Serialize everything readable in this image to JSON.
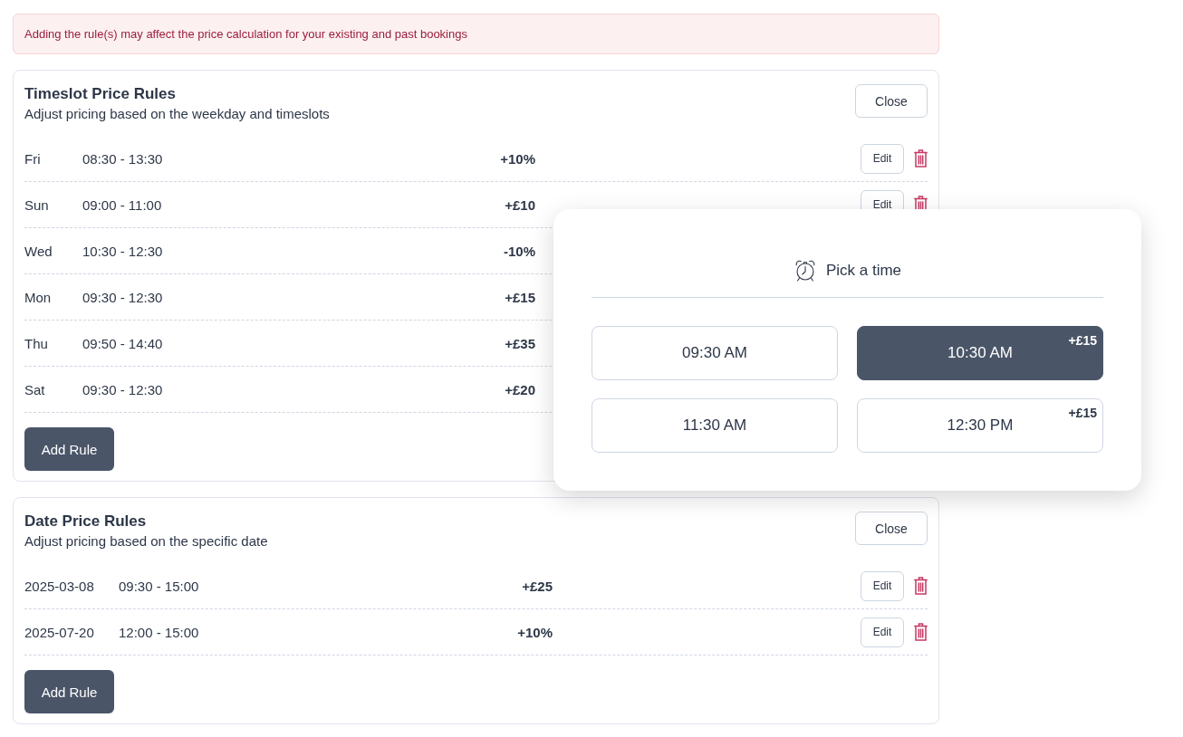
{
  "alert": {
    "text": "Adding the rule(s) may affect the price calculation for your existing and past bookings"
  },
  "sections": [
    {
      "kind": "timeslot",
      "title": "Timeslot Price Rules",
      "subtitle": "Adjust pricing based on the weekday and timeslots",
      "close_label": "Close",
      "rules": [
        {
          "when": "Fri",
          "time": "08:30 - 13:30",
          "adjustment": "+10%",
          "edit_label": "Edit"
        },
        {
          "when": "Sun",
          "time": "09:00 - 11:00",
          "adjustment": "+£10",
          "edit_label": "Edit"
        },
        {
          "when": "Wed",
          "time": "10:30 - 12:30",
          "adjustment": "-10%"
        },
        {
          "when": "Mon",
          "time": "09:30 - 12:30",
          "adjustment": "+£15"
        },
        {
          "when": "Thu",
          "time": "09:50 - 14:40",
          "adjustment": "+£35"
        },
        {
          "when": "Sat",
          "time": "09:30 - 12:30",
          "adjustment": "+£20"
        }
      ],
      "add_label": "Add Rule"
    },
    {
      "kind": "date",
      "title": "Date Price Rules",
      "subtitle": "Adjust pricing based on the specific date",
      "close_label": "Close",
      "rules": [
        {
          "when": "2025-03-08",
          "time": "09:30 - 15:00",
          "adjustment": "+£25",
          "edit_label": "Edit"
        },
        {
          "when": "2025-07-20",
          "time": "12:00 - 15:00",
          "adjustment": "+10%",
          "edit_label": "Edit"
        }
      ],
      "add_label": "Add Rule"
    }
  ],
  "time_picker": {
    "title": "Pick a time",
    "slots": [
      {
        "time": "09:30 AM",
        "selected": false
      },
      {
        "time": "10:30 AM",
        "selected": true,
        "surcharge": "+£15"
      },
      {
        "time": "11:30 AM",
        "selected": false
      },
      {
        "time": "12:30 PM",
        "selected": false,
        "surcharge": "+£15"
      }
    ]
  }
}
